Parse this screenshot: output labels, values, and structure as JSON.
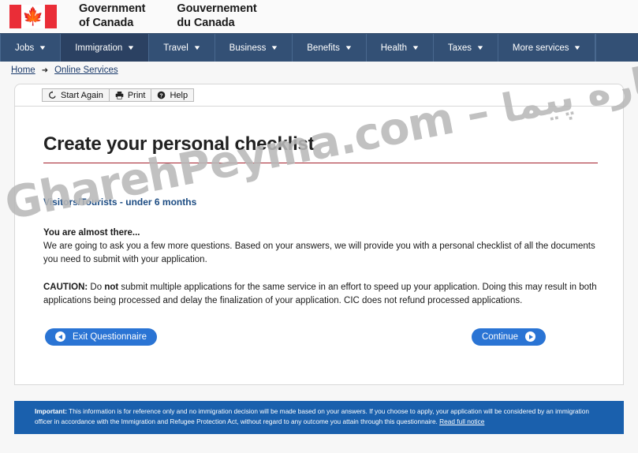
{
  "header": {
    "flag_alt": "canada-flag",
    "wordmark_en_line1": "Government",
    "wordmark_en_line2": "of Canada",
    "wordmark_fr_line1": "Gouvernement",
    "wordmark_fr_line2": "du Canada"
  },
  "nav": {
    "items": [
      {
        "label": "Jobs",
        "active": false
      },
      {
        "label": "Immigration",
        "active": true
      },
      {
        "label": "Travel",
        "active": false
      },
      {
        "label": "Business",
        "active": false
      },
      {
        "label": "Benefits",
        "active": false
      },
      {
        "label": "Health",
        "active": false
      },
      {
        "label": "Taxes",
        "active": false
      },
      {
        "label": "More services",
        "active": false
      }
    ]
  },
  "breadcrumb": {
    "home": "Home",
    "separator": "➜",
    "current": "Online Services"
  },
  "toolbar": {
    "start_again": "Start Again",
    "print": "Print",
    "help": "Help"
  },
  "main": {
    "title": "Create your personal checklist",
    "subtitle": "Visitors/Tourists - under 6 months",
    "lead": "You are almost there...",
    "paragraph": "We are going to ask you a few more questions. Based on your answers, we will provide you with a personal checklist of all the documents you need to submit with your application.",
    "caution_label": "CAUTION:",
    "caution_text_1": " Do ",
    "caution_bold": "not",
    "caution_text_2": " submit multiple applications for the same service in an effort to speed up your application.  Doing this may result in both applications being processed and delay the finalization of your application. CIC does not refund processed applications.",
    "exit_button": "Exit Questionnaire",
    "continue_button": "Continue"
  },
  "notice": {
    "label": "Important:",
    "text": " This information is for reference only and no immigration decision will be made based on your answers. If you choose to apply, your application will be considered by an immigration officer in accordance with the Immigration and Refugee Protection Act, without regard to any outcome you attain through this questionnaire. ",
    "link": "Read full notice"
  },
  "watermark": {
    "text_latin": "GharehPeyma.com – ",
    "text_farsi": "قاره پیما"
  },
  "colors": {
    "nav_bg": "#335075",
    "nav_active": "#2b4162",
    "flag_red": "#EA2D37",
    "title_rule": "#a4202c",
    "subtitle": "#1b4b82",
    "button_blue": "#2a74d4",
    "notice_blue": "#1a60ad"
  }
}
